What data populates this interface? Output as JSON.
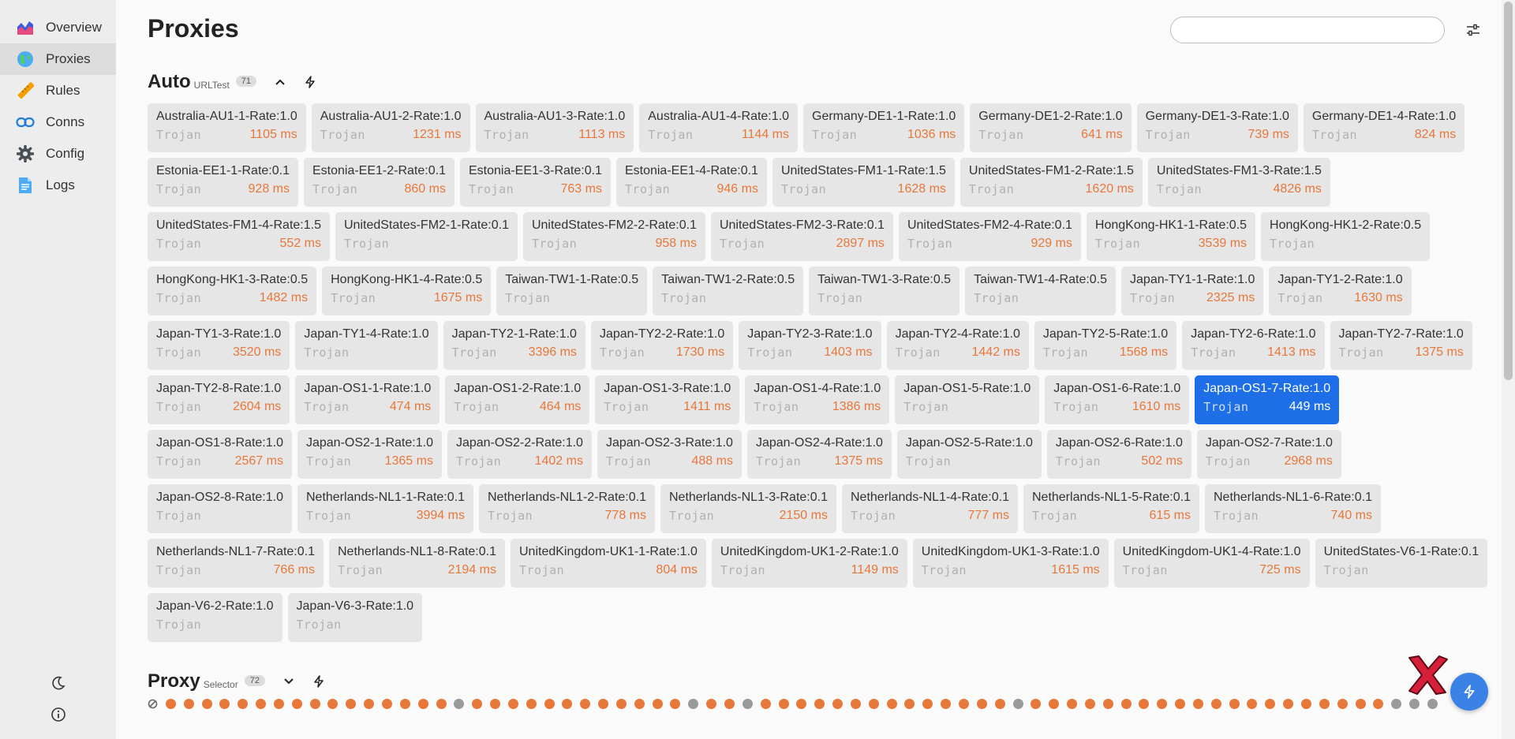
{
  "sidebar": {
    "items": [
      {
        "label": "Overview",
        "icon": "chart-area-icon"
      },
      {
        "label": "Proxies",
        "icon": "globe-icon",
        "active": true
      },
      {
        "label": "Rules",
        "icon": "ruler-icon"
      },
      {
        "label": "Conns",
        "icon": "link-icon"
      },
      {
        "label": "Config",
        "icon": "gear-icon"
      },
      {
        "label": "Logs",
        "icon": "document-icon"
      }
    ]
  },
  "page": {
    "title": "Proxies",
    "search": {
      "value": "",
      "placeholder": ""
    }
  },
  "colors": {
    "accent": "#1e6ee8",
    "delay": "#e8773a",
    "dot_ok": "#e8773a",
    "dot_na": "#9a9a9a"
  },
  "groups": [
    {
      "name": "Auto",
      "type": "URLTest",
      "count": "71",
      "proxies": [
        {
          "name": "Australia-AU1-1-Rate:1.0",
          "type": "Trojan",
          "delay": "1105 ms"
        },
        {
          "name": "Australia-AU1-2-Rate:1.0",
          "type": "Trojan",
          "delay": "1231 ms"
        },
        {
          "name": "Australia-AU1-3-Rate:1.0",
          "type": "Trojan",
          "delay": "1113 ms"
        },
        {
          "name": "Australia-AU1-4-Rate:1.0",
          "type": "Trojan",
          "delay": "1144 ms"
        },
        {
          "name": "Germany-DE1-1-Rate:1.0",
          "type": "Trojan",
          "delay": "1036 ms"
        },
        {
          "name": "Germany-DE1-2-Rate:1.0",
          "type": "Trojan",
          "delay": "641 ms"
        },
        {
          "name": "Germany-DE1-3-Rate:1.0",
          "type": "Trojan",
          "delay": "739 ms"
        },
        {
          "name": "Germany-DE1-4-Rate:1.0",
          "type": "Trojan",
          "delay": "824 ms"
        },
        {
          "name": "Estonia-EE1-1-Rate:0.1",
          "type": "Trojan",
          "delay": "928 ms"
        },
        {
          "name": "Estonia-EE1-2-Rate:0.1",
          "type": "Trojan",
          "delay": "860 ms"
        },
        {
          "name": "Estonia-EE1-3-Rate:0.1",
          "type": "Trojan",
          "delay": "763 ms"
        },
        {
          "name": "Estonia-EE1-4-Rate:0.1",
          "type": "Trojan",
          "delay": "946 ms"
        },
        {
          "name": "UnitedStates-FM1-1-Rate:1.5",
          "type": "Trojan",
          "delay": "1628 ms"
        },
        {
          "name": "UnitedStates-FM1-2-Rate:1.5",
          "type": "Trojan",
          "delay": "1620 ms"
        },
        {
          "name": "UnitedStates-FM1-3-Rate:1.5",
          "type": "Trojan",
          "delay": "4826 ms"
        },
        {
          "name": "UnitedStates-FM1-4-Rate:1.5",
          "type": "Trojan",
          "delay": "552 ms"
        },
        {
          "name": "UnitedStates-FM2-1-Rate:0.1",
          "type": "Trojan",
          "delay": ""
        },
        {
          "name": "UnitedStates-FM2-2-Rate:0.1",
          "type": "Trojan",
          "delay": "958 ms"
        },
        {
          "name": "UnitedStates-FM2-3-Rate:0.1",
          "type": "Trojan",
          "delay": "2897 ms"
        },
        {
          "name": "UnitedStates-FM2-4-Rate:0.1",
          "type": "Trojan",
          "delay": "929 ms"
        },
        {
          "name": "HongKong-HK1-1-Rate:0.5",
          "type": "Trojan",
          "delay": "3539 ms"
        },
        {
          "name": "HongKong-HK1-2-Rate:0.5",
          "type": "Trojan",
          "delay": ""
        },
        {
          "name": "HongKong-HK1-3-Rate:0.5",
          "type": "Trojan",
          "delay": "1482 ms"
        },
        {
          "name": "HongKong-HK1-4-Rate:0.5",
          "type": "Trojan",
          "delay": "1675 ms"
        },
        {
          "name": "Taiwan-TW1-1-Rate:0.5",
          "type": "Trojan",
          "delay": ""
        },
        {
          "name": "Taiwan-TW1-2-Rate:0.5",
          "type": "Trojan",
          "delay": ""
        },
        {
          "name": "Taiwan-TW1-3-Rate:0.5",
          "type": "Trojan",
          "delay": ""
        },
        {
          "name": "Taiwan-TW1-4-Rate:0.5",
          "type": "Trojan",
          "delay": ""
        },
        {
          "name": "Japan-TY1-1-Rate:1.0",
          "type": "Trojan",
          "delay": "2325 ms"
        },
        {
          "name": "Japan-TY1-2-Rate:1.0",
          "type": "Trojan",
          "delay": "1630 ms"
        },
        {
          "name": "Japan-TY1-3-Rate:1.0",
          "type": "Trojan",
          "delay": "3520 ms"
        },
        {
          "name": "Japan-TY1-4-Rate:1.0",
          "type": "Trojan",
          "delay": ""
        },
        {
          "name": "Japan-TY2-1-Rate:1.0",
          "type": "Trojan",
          "delay": "3396 ms"
        },
        {
          "name": "Japan-TY2-2-Rate:1.0",
          "type": "Trojan",
          "delay": "1730 ms"
        },
        {
          "name": "Japan-TY2-3-Rate:1.0",
          "type": "Trojan",
          "delay": "1403 ms"
        },
        {
          "name": "Japan-TY2-4-Rate:1.0",
          "type": "Trojan",
          "delay": "1442 ms"
        },
        {
          "name": "Japan-TY2-5-Rate:1.0",
          "type": "Trojan",
          "delay": "1568 ms"
        },
        {
          "name": "Japan-TY2-6-Rate:1.0",
          "type": "Trojan",
          "delay": "1413 ms"
        },
        {
          "name": "Japan-TY2-7-Rate:1.0",
          "type": "Trojan",
          "delay": "1375 ms"
        },
        {
          "name": "Japan-TY2-8-Rate:1.0",
          "type": "Trojan",
          "delay": "2604 ms"
        },
        {
          "name": "Japan-OS1-1-Rate:1.0",
          "type": "Trojan",
          "delay": "474 ms"
        },
        {
          "name": "Japan-OS1-2-Rate:1.0",
          "type": "Trojan",
          "delay": "464 ms"
        },
        {
          "name": "Japan-OS1-3-Rate:1.0",
          "type": "Trojan",
          "delay": "1411 ms"
        },
        {
          "name": "Japan-OS1-4-Rate:1.0",
          "type": "Trojan",
          "delay": "1386 ms"
        },
        {
          "name": "Japan-OS1-5-Rate:1.0",
          "type": "Trojan",
          "delay": ""
        },
        {
          "name": "Japan-OS1-6-Rate:1.0",
          "type": "Trojan",
          "delay": "1610 ms"
        },
        {
          "name": "Japan-OS1-7-Rate:1.0",
          "type": "Trojan",
          "delay": "449 ms",
          "selected": true
        },
        {
          "name": "Japan-OS1-8-Rate:1.0",
          "type": "Trojan",
          "delay": "2567 ms"
        },
        {
          "name": "Japan-OS2-1-Rate:1.0",
          "type": "Trojan",
          "delay": "1365 ms"
        },
        {
          "name": "Japan-OS2-2-Rate:1.0",
          "type": "Trojan",
          "delay": "1402 ms"
        },
        {
          "name": "Japan-OS2-3-Rate:1.0",
          "type": "Trojan",
          "delay": "488 ms"
        },
        {
          "name": "Japan-OS2-4-Rate:1.0",
          "type": "Trojan",
          "delay": "1375 ms"
        },
        {
          "name": "Japan-OS2-5-Rate:1.0",
          "type": "Trojan",
          "delay": ""
        },
        {
          "name": "Japan-OS2-6-Rate:1.0",
          "type": "Trojan",
          "delay": "502 ms"
        },
        {
          "name": "Japan-OS2-7-Rate:1.0",
          "type": "Trojan",
          "delay": "2968 ms"
        },
        {
          "name": "Japan-OS2-8-Rate:1.0",
          "type": "Trojan",
          "delay": ""
        },
        {
          "name": "Netherlands-NL1-1-Rate:0.1",
          "type": "Trojan",
          "delay": "3994 ms"
        },
        {
          "name": "Netherlands-NL1-2-Rate:0.1",
          "type": "Trojan",
          "delay": "778 ms"
        },
        {
          "name": "Netherlands-NL1-3-Rate:0.1",
          "type": "Trojan",
          "delay": "2150 ms"
        },
        {
          "name": "Netherlands-NL1-4-Rate:0.1",
          "type": "Trojan",
          "delay": "777 ms"
        },
        {
          "name": "Netherlands-NL1-5-Rate:0.1",
          "type": "Trojan",
          "delay": "615 ms"
        },
        {
          "name": "Netherlands-NL1-6-Rate:0.1",
          "type": "Trojan",
          "delay": "740 ms"
        },
        {
          "name": "Netherlands-NL1-7-Rate:0.1",
          "type": "Trojan",
          "delay": "766 ms"
        },
        {
          "name": "Netherlands-NL1-8-Rate:0.1",
          "type": "Trojan",
          "delay": "2194 ms"
        },
        {
          "name": "UnitedKingdom-UK1-1-Rate:1.0",
          "type": "Trojan",
          "delay": "804 ms"
        },
        {
          "name": "UnitedKingdom-UK1-2-Rate:1.0",
          "type": "Trojan",
          "delay": "1149 ms"
        },
        {
          "name": "UnitedKingdom-UK1-3-Rate:1.0",
          "type": "Trojan",
          "delay": "1615 ms"
        },
        {
          "name": "UnitedKingdom-UK1-4-Rate:1.0",
          "type": "Trojan",
          "delay": "725 ms"
        },
        {
          "name": "UnitedStates-V6-1-Rate:0.1",
          "type": "Trojan",
          "delay": ""
        },
        {
          "name": "Japan-V6-2-Rate:1.0",
          "type": "Trojan",
          "delay": ""
        },
        {
          "name": "Japan-V6-3-Rate:1.0",
          "type": "Trojan",
          "delay": ""
        }
      ]
    },
    {
      "name": "Proxy",
      "type": "Selector",
      "count": "72",
      "dots": [
        "none",
        "ok",
        "ok",
        "ok",
        "ok",
        "ok",
        "ok",
        "ok",
        "ok",
        "ok",
        "ok",
        "ok",
        "ok",
        "ok",
        "ok",
        "ok",
        "ok",
        "na",
        "ok",
        "ok",
        "ok",
        "ok",
        "ok",
        "ok",
        "ok",
        "ok",
        "ok",
        "ok",
        "ok",
        "ok",
        "na",
        "ok",
        "ok",
        "na",
        "ok",
        "ok",
        "ok",
        "ok",
        "ok",
        "ok",
        "ok",
        "ok",
        "ok",
        "ok",
        "ok",
        "ok",
        "ok",
        "ok",
        "na",
        "ok",
        "ok",
        "ok",
        "ok",
        "ok",
        "ok",
        "ok",
        "ok",
        "ok",
        "ok",
        "ok",
        "ok",
        "ok",
        "ok",
        "ok",
        "ok",
        "ok",
        "ok",
        "ok",
        "ok",
        "na",
        "na",
        "na"
      ]
    }
  ]
}
